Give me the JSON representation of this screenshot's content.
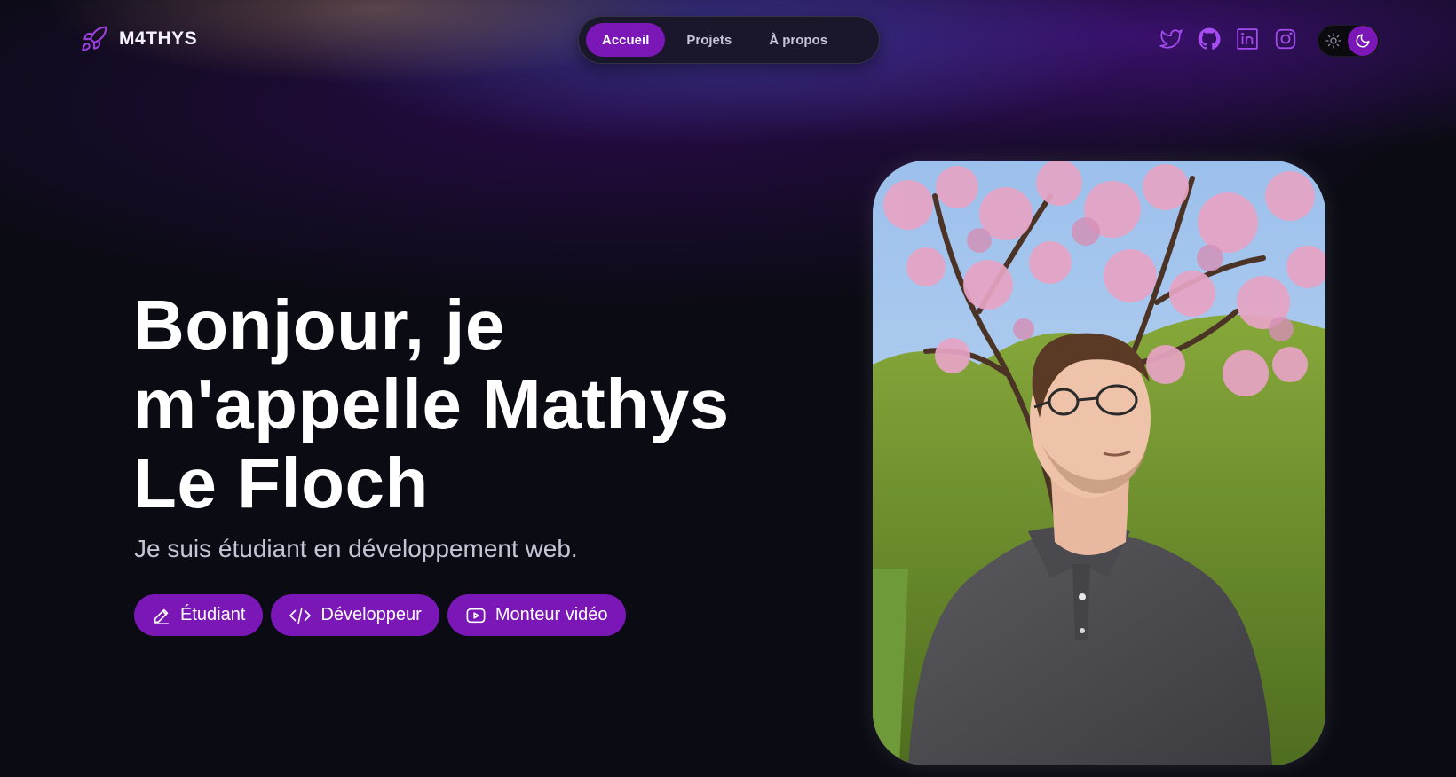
{
  "header": {
    "logo_text": "M4THYS",
    "logo_icon": "rocket-icon",
    "nav": [
      {
        "label": "Accueil",
        "active": true
      },
      {
        "label": "Projets",
        "active": false
      },
      {
        "label": "À propos",
        "active": false
      }
    ],
    "socials": [
      {
        "icon": "twitter-icon"
      },
      {
        "icon": "github-icon"
      },
      {
        "icon": "linkedin-icon"
      },
      {
        "icon": "instagram-icon"
      }
    ],
    "theme_toggle": {
      "options": [
        "sun-icon",
        "moon-icon"
      ],
      "selected": "moon-icon"
    }
  },
  "hero": {
    "title": "Bonjour, je m'appelle Mathys Le Floch",
    "subtitle": "Je suis étudiant en développement web.",
    "chips": [
      {
        "label": "Étudiant",
        "icon": "pencil-icon"
      },
      {
        "label": "Développeur",
        "icon": "code-icon"
      },
      {
        "label": "Monteur vidéo",
        "icon": "video-play-icon"
      }
    ],
    "photo": {
      "icon": "profile-photo"
    }
  },
  "colors": {
    "accent": "#7b17b6",
    "background": "#0b0b14",
    "text": "#ffffff",
    "muted_text": "#c3c5d4"
  }
}
